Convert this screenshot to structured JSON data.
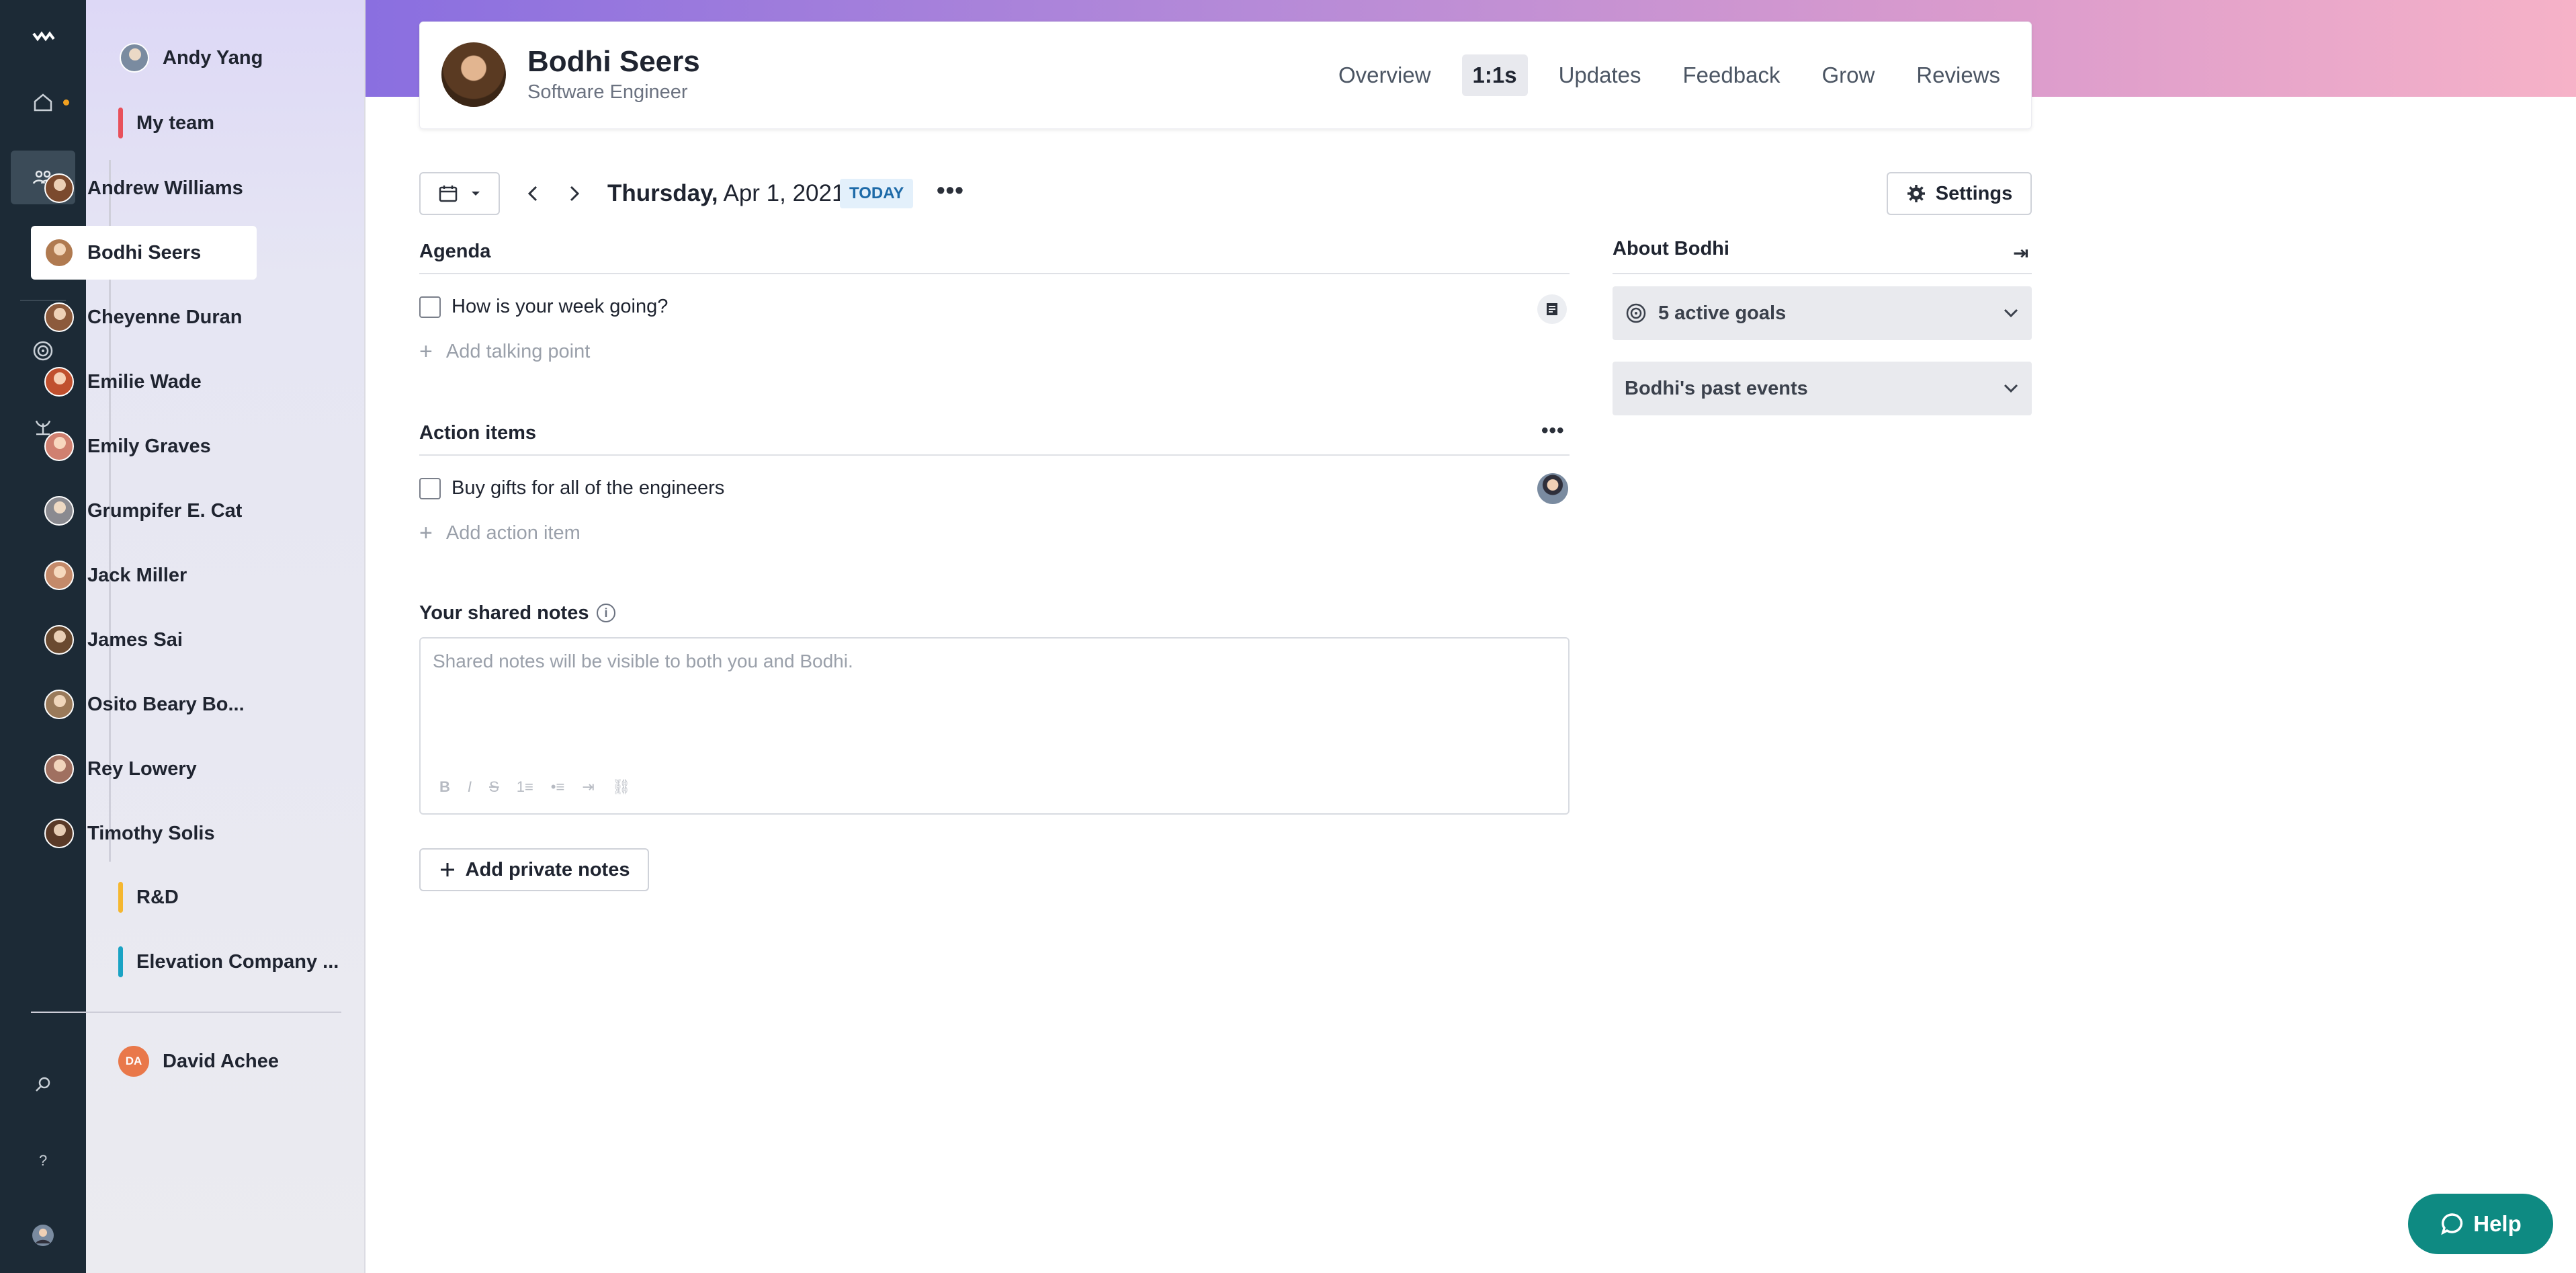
{
  "rail": {
    "items": [
      "logo",
      "home",
      "team",
      "insights",
      "goals",
      "grow",
      "search",
      "help",
      "profile"
    ]
  },
  "sidebar": {
    "current_user": "Andy Yang",
    "my_team_label": "My team",
    "members": [
      {
        "name": "Andrew Williams",
        "color": "#7b4a2e"
      },
      {
        "name": "Bodhi Seers",
        "color": "#b07a50"
      },
      {
        "name": "Cheyenne Duran",
        "color": "#8c5a3c"
      },
      {
        "name": "Emilie Wade",
        "color": "#c0502e"
      },
      {
        "name": "Emily Graves",
        "color": "#d08070"
      },
      {
        "name": "Grumpifer E. Cat",
        "color": "#8a8a90"
      },
      {
        "name": "Jack Miller",
        "color": "#c48a6a"
      },
      {
        "name": "James Sai",
        "color": "#6a4a30"
      },
      {
        "name": "Osito Beary Bo...",
        "color": "#9a7a5a"
      },
      {
        "name": "Rey Lowery",
        "color": "#a07060"
      },
      {
        "name": "Timothy Solis",
        "color": "#5a3a28"
      }
    ],
    "groups": [
      {
        "label": "R&D",
        "color": "#f5b730"
      },
      {
        "label": "Elevation Company ...",
        "color": "#1aa3c4"
      }
    ],
    "other_user": {
      "initials": "DA",
      "name": "David Achee"
    },
    "my_team_color": "#e8505b"
  },
  "header": {
    "name": "Bodhi Seers",
    "role": "Software Engineer",
    "tabs": [
      "Overview",
      "1:1s",
      "Updates",
      "Feedback",
      "Grow",
      "Reviews"
    ],
    "active_tab": "1:1s"
  },
  "toolbar": {
    "weekday": "Thursday,",
    "date": "Apr 1, 2021",
    "today": "TODAY",
    "settings": "Settings"
  },
  "agenda": {
    "title": "Agenda",
    "items": [
      "How is your week going?"
    ],
    "add_label": "Add talking point"
  },
  "action_items": {
    "title": "Action items",
    "items": [
      "Buy gifts for all of the engineers"
    ],
    "add_label": "Add action item"
  },
  "notes": {
    "title": "Your shared notes",
    "placeholder": "Shared notes will be visible to both you and Bodhi.",
    "format_tools": [
      "B",
      "I",
      "S",
      "1≡",
      "•≡",
      "⇥",
      "⛓"
    ],
    "private_label": "Add private notes"
  },
  "about": {
    "title": "About Bodhi",
    "goals": "5 active goals",
    "past_events": "Bodhi's past events"
  },
  "help": {
    "label": "Help"
  }
}
